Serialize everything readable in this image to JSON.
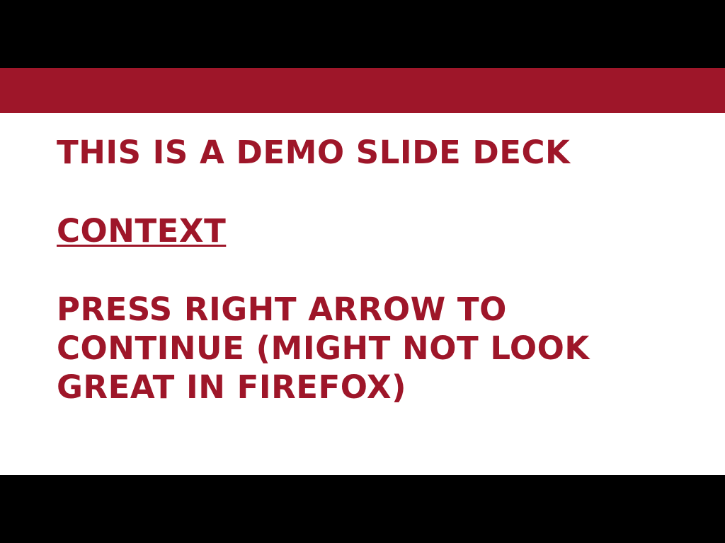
{
  "theme": {
    "accent": "#9e1629",
    "letterbox": "#000000",
    "slide_background": "#ffffff"
  },
  "slide": {
    "title": "This is a demo slide deck",
    "link_label": "Context",
    "instruction": "Press right arrow to continue (might not look great in Firefox)"
  }
}
